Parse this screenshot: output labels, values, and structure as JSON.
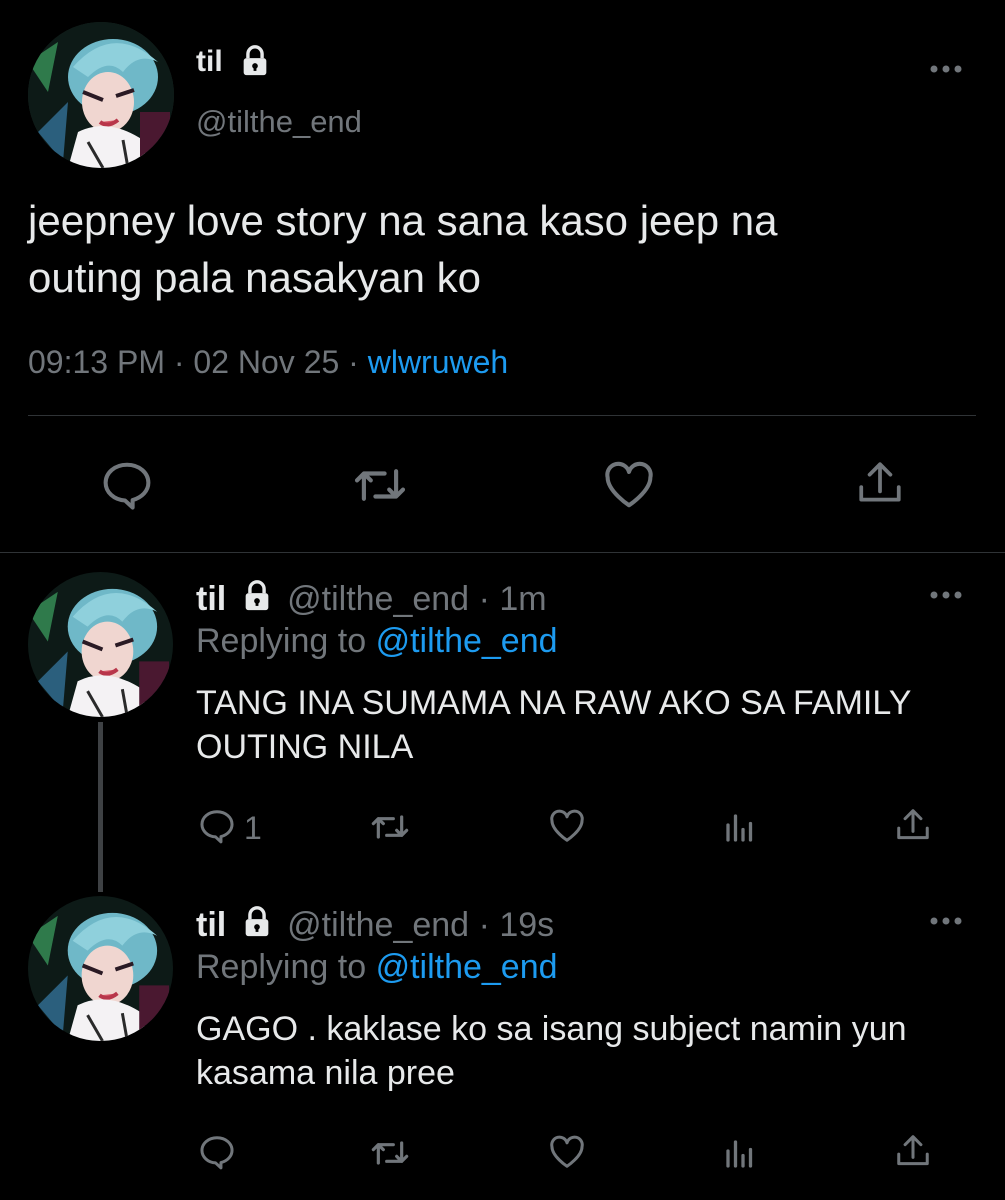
{
  "main_tweet": {
    "display_name": "til",
    "handle": "@tilthe_end",
    "text_line1": "jeepney love story na sana kaso jeep na",
    "text_line2": "outing pala nasakyan ko",
    "time": "09:13 PM",
    "date": "02 Nov 25",
    "sep": "·",
    "source": "wlwruweh"
  },
  "replies": [
    {
      "display_name": "til",
      "handle": "@tilthe_end",
      "age": "1m",
      "replying_prefix": "Replying to",
      "replying_to": "@tilthe_end",
      "text_line1": "TANG INA SUMAMA NA RAW AKO SA FAMILY",
      "text_line2": "OUTING NILA",
      "reply_count": "1"
    },
    {
      "display_name": "til",
      "handle": "@tilthe_end",
      "age": "19s",
      "replying_prefix": "Replying to",
      "replying_to": "@tilthe_end",
      "text_line1": "GAGO . kaklase ko sa isang subject namin yun",
      "text_line2": "kasama nila pree",
      "reply_count": ""
    }
  ],
  "icons": {
    "more": "more-horizontal-icon",
    "reply": "reply-bubble-icon",
    "retweet": "retweet-icon",
    "like": "heart-icon",
    "share": "share-icon",
    "views": "analytics-icon",
    "lock": "lock-icon"
  },
  "colors": {
    "background": "#000000",
    "text": "#e7e9ea",
    "muted": "#71767b",
    "accent": "#1d9bf0"
  }
}
